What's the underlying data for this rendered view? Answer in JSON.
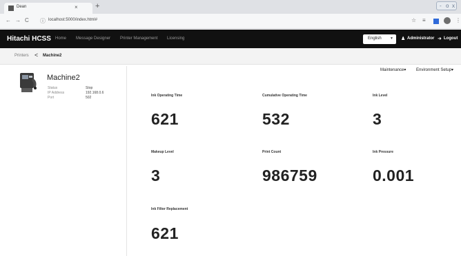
{
  "browser": {
    "tab_title": "Dean",
    "tab_close": "×",
    "new_tab": "+",
    "url": "localhost:5000/index.html#",
    "window_controls": [
      "-",
      "o",
      "x"
    ]
  },
  "navbar": {
    "brand": "Hitachi HCSS",
    "links": [
      "Home",
      "Message Designer",
      "Printer Management",
      "Licensing"
    ],
    "language": "English",
    "user": "Administrator",
    "logout": "Logout"
  },
  "breadcrumb": {
    "parent": "Printers",
    "separator": "<",
    "current": "Machine2"
  },
  "device": {
    "name": "Machine2",
    "properties": [
      {
        "label": "Status",
        "value": "Stop"
      },
      {
        "label": "IP Address",
        "value": "192.168.0.6"
      },
      {
        "label": "Port",
        "value": "502"
      }
    ]
  },
  "menus": {
    "maintenance": "Maintenance",
    "environment": "Environment Setup"
  },
  "metrics": [
    {
      "label": "Ink Operating Time",
      "value": "621"
    },
    {
      "label": "Cumulative Operating Time",
      "value": "532"
    },
    {
      "label": "Ink Level",
      "value": "3"
    },
    {
      "label": "Makeup Level",
      "value": "3"
    },
    {
      "label": "Print Count",
      "value": "986759"
    },
    {
      "label": "Ink Pressure",
      "value": "0.001"
    },
    {
      "label": "Ink Filter Replacement",
      "value": "621"
    }
  ]
}
